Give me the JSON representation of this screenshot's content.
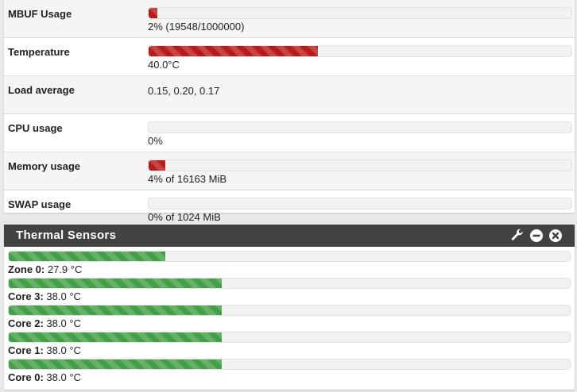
{
  "system_info": {
    "rows": [
      {
        "label": "MBUF Usage",
        "value": "2% (19548/1000000)",
        "percent": 2,
        "color": "#b71c1c"
      },
      {
        "label": "Temperature",
        "value": "40.0°C",
        "percent": 40,
        "color": "#b71c1c"
      },
      {
        "label": "Load average",
        "value": "0.15, 0.20, 0.17"
      },
      {
        "label": "CPU usage",
        "value": "0%",
        "percent": 0,
        "color": "#b71c1c"
      },
      {
        "label": "Memory usage",
        "value": "4% of 16163 MiB",
        "percent": 4,
        "color": "#b71c1c"
      },
      {
        "label": "SWAP usage",
        "value": "0% of 1024 MiB",
        "percent": 0,
        "color": "#b71c1c"
      }
    ]
  },
  "thermal": {
    "title": "Thermal Sensors",
    "icons": [
      "wrench-icon",
      "minimize-icon",
      "close-icon"
    ],
    "bar_color": "#43a047",
    "sensors": [
      {
        "name": "Zone 0:",
        "value": "27.9 °C",
        "percent": 27.9
      },
      {
        "name": "Core 3:",
        "value": "38.0 °C",
        "percent": 38
      },
      {
        "name": "Core 2:",
        "value": "38.0 °C",
        "percent": 38
      },
      {
        "name": "Core 1:",
        "value": "38.0 °C",
        "percent": 38
      },
      {
        "name": "Core 0:",
        "value": "38.0 °C",
        "percent": 38
      }
    ]
  }
}
